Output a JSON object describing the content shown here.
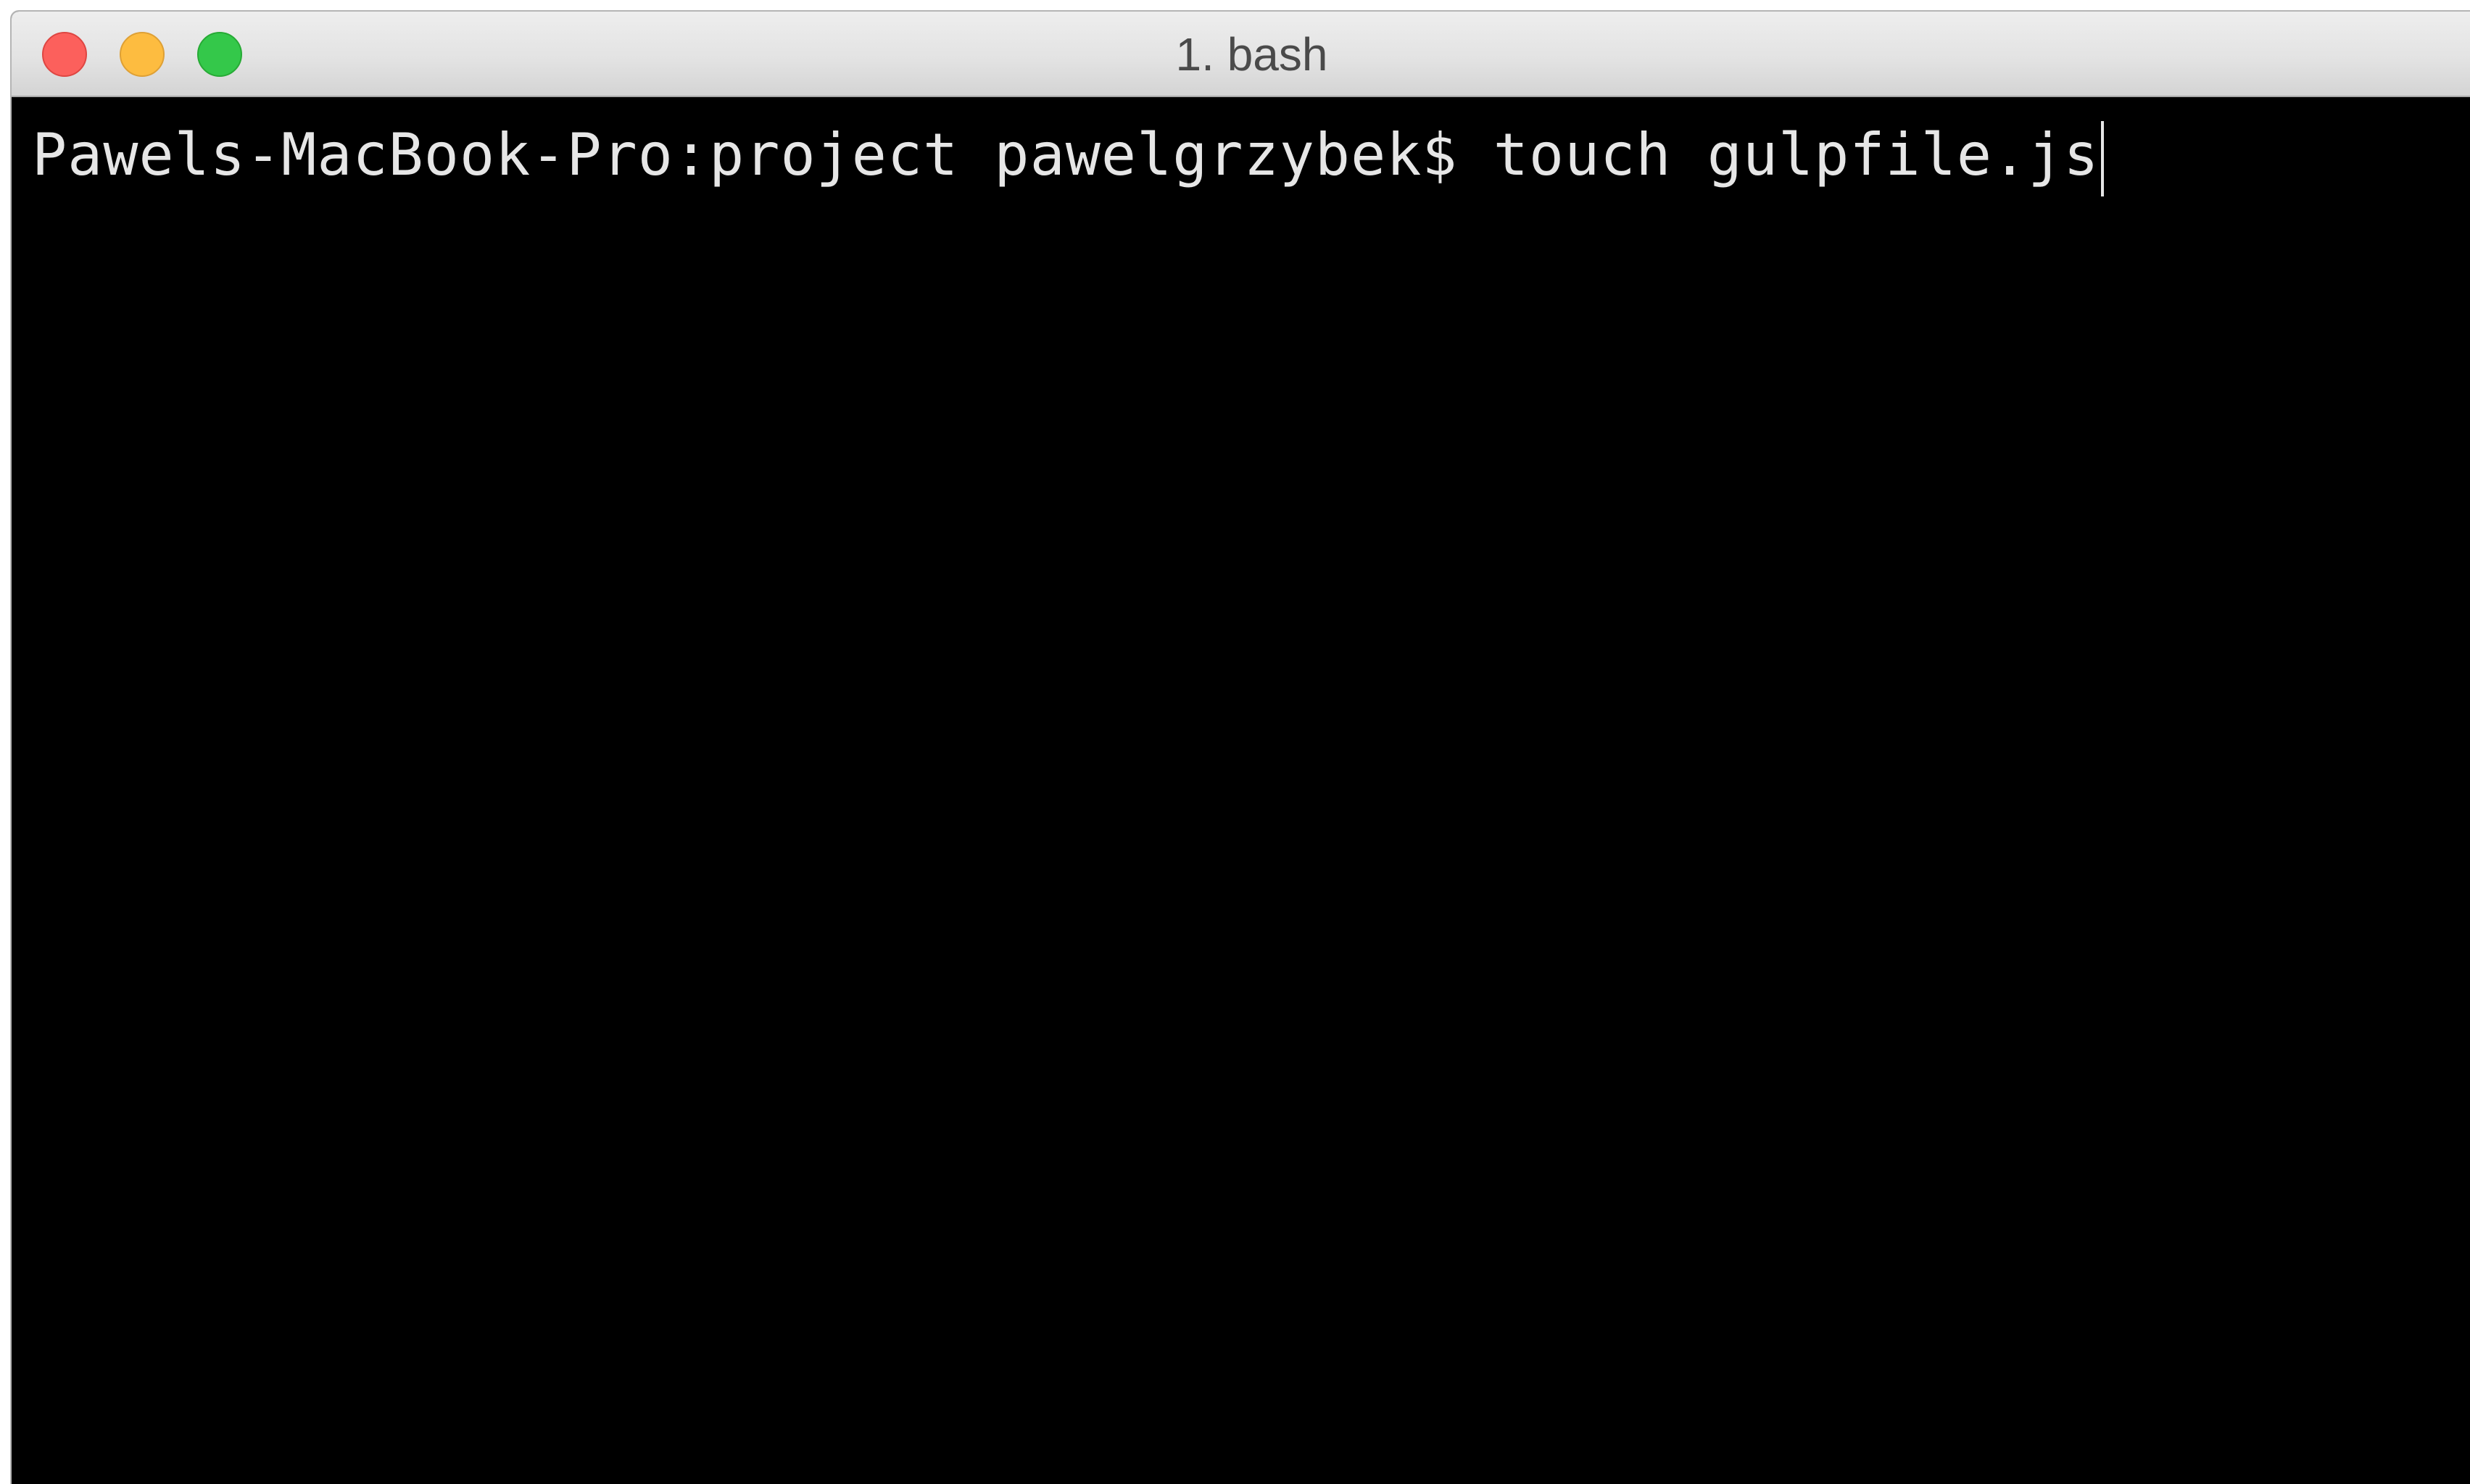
{
  "window": {
    "title": "1. bash",
    "controls": {
      "close_icon": "close-icon",
      "minimize_icon": "minimize-icon",
      "zoom_icon": "zoom-icon",
      "close_color": "#fc605c",
      "minimize_color": "#fdbc40",
      "zoom_color": "#34c84a"
    }
  },
  "terminal": {
    "prompt": "Pawels-MacBook-Pro:project pawelgrzybek$ ",
    "command": "touch gulpfile.js",
    "background": "#000000",
    "foreground": "#e6e6e6"
  }
}
